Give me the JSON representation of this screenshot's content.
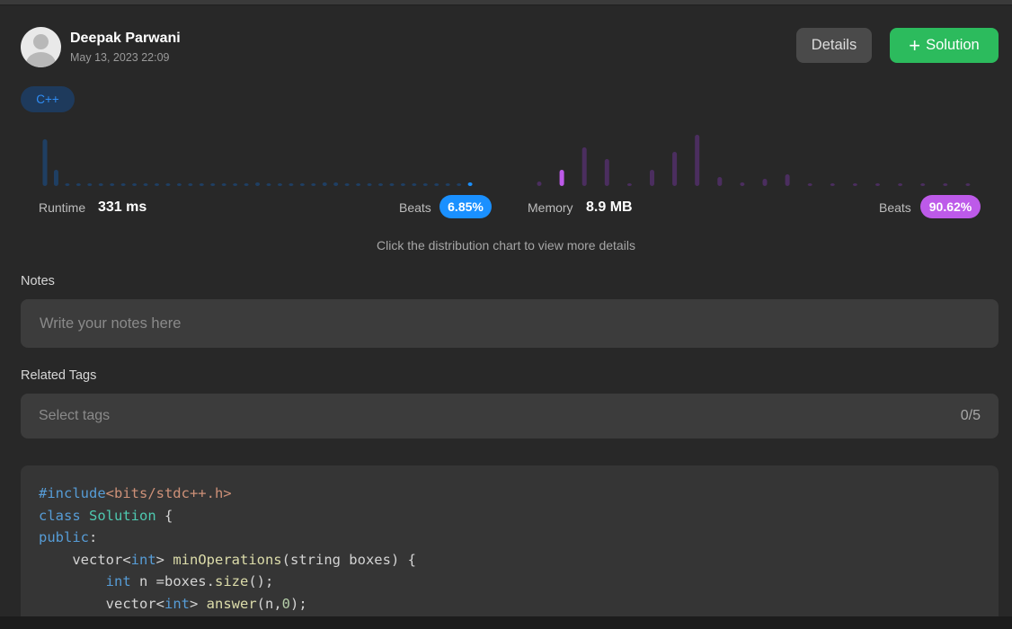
{
  "submission": {
    "user_name": "Deepak Parwani",
    "timestamp": "May 13, 2023 22:09",
    "language": "C++"
  },
  "actions": {
    "details_label": "Details",
    "solution_label": "Solution",
    "solution_icon": "plus-icon"
  },
  "runtime": {
    "label": "Runtime",
    "value": "331 ms",
    "beats_label": "Beats",
    "beats_value": "6.85%",
    "color": "#1a90ff"
  },
  "memory": {
    "label": "Memory",
    "value": "8.9 MB",
    "beats_label": "Beats",
    "beats_value": "90.62%",
    "color": "#bd5ae9"
  },
  "chart_data": [
    {
      "type": "bar",
      "name": "runtime-distribution",
      "values": [
        52,
        18,
        2,
        2,
        2,
        2,
        2,
        2,
        2,
        2,
        2,
        2,
        2,
        2,
        2,
        2,
        2,
        2,
        2,
        4,
        2,
        2,
        2,
        2,
        3,
        4,
        4,
        2,
        3,
        3,
        2,
        2,
        2,
        2,
        2,
        2,
        2,
        2,
        4
      ],
      "highlight_index": 38,
      "title": "",
      "xlabel": "",
      "ylabel": ""
    },
    {
      "type": "bar",
      "name": "memory-distribution",
      "values": [
        5,
        18,
        43,
        30,
        3,
        18,
        38,
        57,
        10,
        4,
        8,
        13,
        2,
        2,
        2,
        2,
        2,
        2,
        2,
        2
      ],
      "highlight_index": 1,
      "title": "",
      "xlabel": "",
      "ylabel": ""
    }
  ],
  "hint": "Click the distribution chart to view more details",
  "notes": {
    "label": "Notes",
    "placeholder": "Write your notes here"
  },
  "tags": {
    "label": "Related Tags",
    "placeholder": "Select tags",
    "count": "0/5"
  },
  "code": {
    "lines": [
      "#include<bits/stdc++.h>",
      "class Solution {",
      "public:",
      "    vector<int> minOperations(string boxes) {",
      "        int n =boxes.size();",
      "        vector<int> answer(n,0);"
    ]
  }
}
